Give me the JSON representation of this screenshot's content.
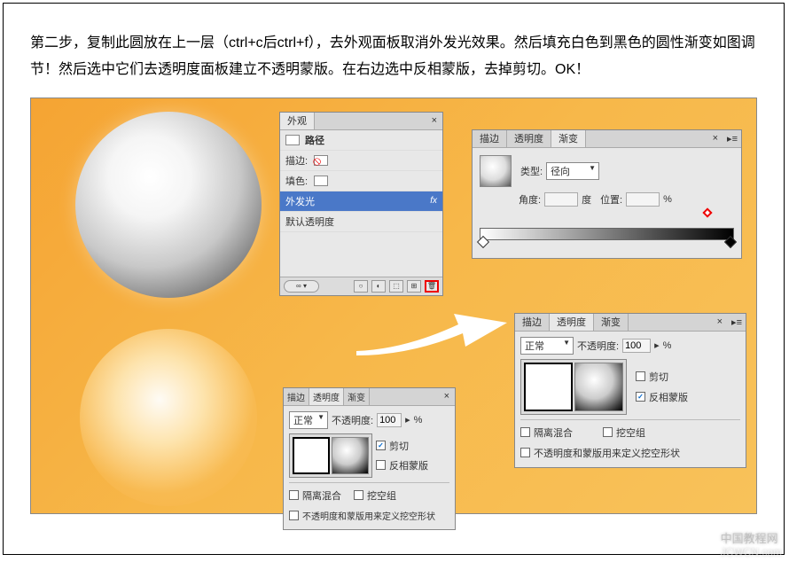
{
  "instruction": "第二步，复制此圆放在上一层（ctrl+c后ctrl+f），去外观面板取消外发光效果。然后填充白色到黑色的圆性渐变如图调节！然后选中它们去透明度面板建立不透明蒙版。在右边选中反相蒙版，去掉剪切。OK！",
  "appearance": {
    "tab": "外观",
    "path": "路径",
    "stroke": "描边:",
    "fill": "填色:",
    "outerGlow": "外发光",
    "defaultTrans": "默认透明度",
    "fx": "fx"
  },
  "gradient": {
    "tabs": {
      "stroke": "描边",
      "trans": "透明度",
      "grad": "渐变"
    },
    "typeLabel": "类型:",
    "typeValue": "径向",
    "angleLabel": "角度:",
    "degree": "度",
    "posLabel": "位置:",
    "percent": "%"
  },
  "transSmall": {
    "tabs": {
      "stroke": "描边",
      "trans": "透明度",
      "grad": "渐变"
    },
    "mode": "正常",
    "opacityLabel": "不透明度:",
    "opacityVal": "100",
    "arrowBtn": "▸",
    "percent": "%",
    "clip": "剪切",
    "invert": "反相蒙版",
    "isolate": "隔离混合",
    "knockout": "挖空组",
    "defineOpacity": "不透明度和蒙版用来定义挖空形状"
  },
  "transLarge": {
    "tabs": {
      "stroke": "描边",
      "trans": "透明度",
      "grad": "渐变"
    },
    "mode": "正常",
    "opacityLabel": "不透明度:",
    "opacityVal": "100",
    "arrowBtn": "▸",
    "percent": "%",
    "clip": "剪切",
    "invert": "反相蒙版",
    "isolate": "隔离混合",
    "knockout": "挖空组",
    "defineOpacity": "不透明度和蒙版用来定义挖空形状"
  },
  "watermark": {
    "cn": "中国教程网",
    "url": "JCWCN.com"
  }
}
